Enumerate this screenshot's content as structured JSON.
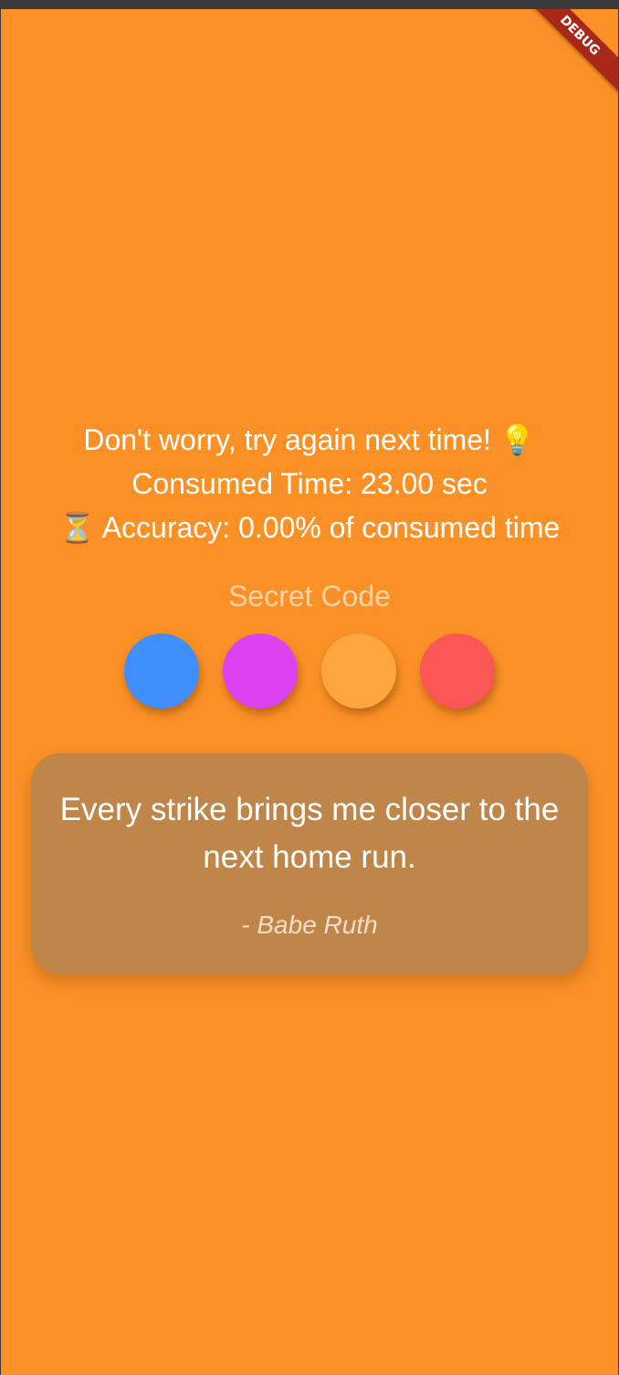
{
  "debug_banner": {
    "label": "DEBUG"
  },
  "result": {
    "message": "Don't worry, try again next time! 💡",
    "time_line": "Consumed Time: 23.00 sec",
    "accuracy_line": "⏳ Accuracy: 0.00% of consumed time"
  },
  "secret_code": {
    "title": "Secret Code",
    "pegs": [
      {
        "color": "#3f8efc"
      },
      {
        "color": "#dc42f2"
      },
      {
        "color": "#fda53f"
      },
      {
        "color": "#fa5754"
      }
    ]
  },
  "quote": {
    "text": "Every strike brings me closer to the next home run.",
    "author": "- Babe Ruth"
  }
}
